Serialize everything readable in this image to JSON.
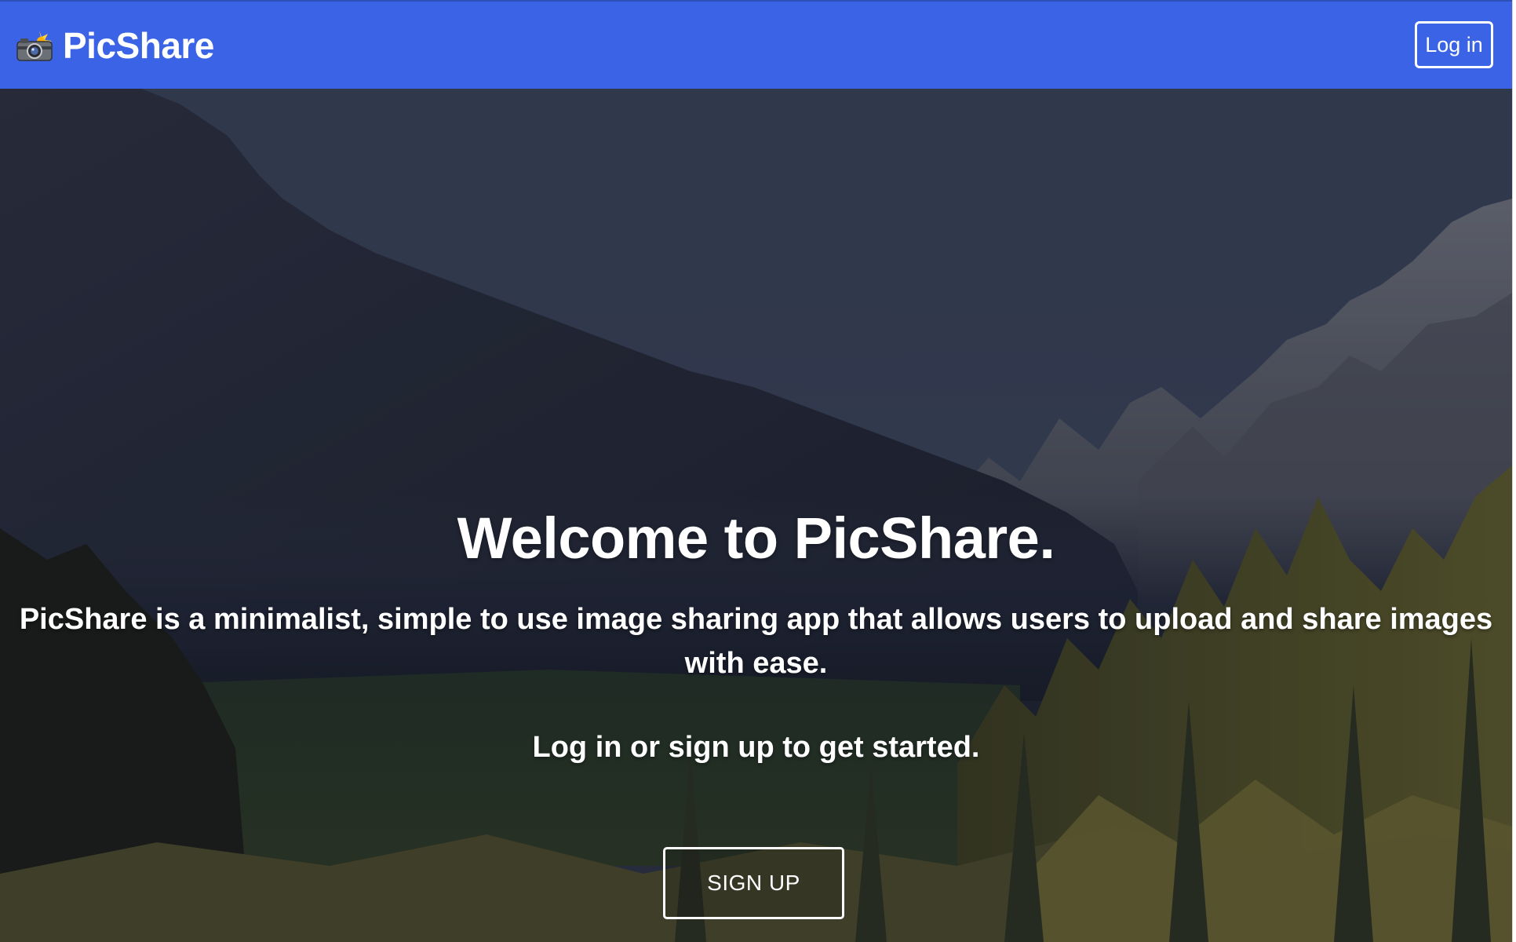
{
  "navbar": {
    "brand_name": "PicShare",
    "brand_icon": "camera-flash-icon",
    "login_label": "Log in",
    "background_color": "#3b63e6"
  },
  "hero": {
    "title": "Welcome to PicShare.",
    "description": "PicShare is a minimalist, simple to use image sharing app that allows users to upload and share images with ease.",
    "cta_text": "Log in or sign up to get started.",
    "signup_label": "SIGN UP",
    "background_image": "mountain-forest-landscape"
  }
}
